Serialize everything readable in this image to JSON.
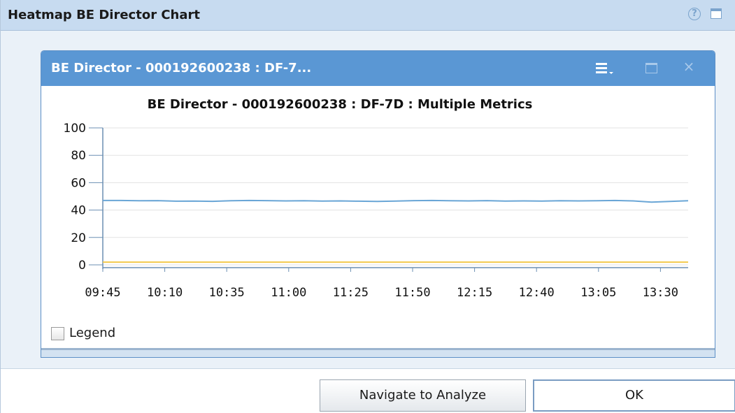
{
  "dialog": {
    "title": "Heatmap BE Director Chart",
    "help_icon": "help-circle-icon",
    "maximize_icon": "maximize-icon"
  },
  "panel": {
    "title": "BE Director - 000192600238 : DF-7...",
    "menu_icon": "panel-menu-icon",
    "maximize_icon": "panel-maximize-icon",
    "close_icon": "close-icon",
    "close_glyph": "×"
  },
  "chart_data": {
    "type": "line",
    "title": "BE Director - 000192600238 : DF-7D : Multiple Metrics",
    "xlabel": "",
    "ylabel": "",
    "ylim": [
      0,
      100
    ],
    "yticks": [
      0,
      20,
      40,
      60,
      80,
      100
    ],
    "xticks": [
      "09:45",
      "10:10",
      "10:35",
      "11:00",
      "11:25",
      "11:50",
      "12:15",
      "12:40",
      "13:05",
      "13:30"
    ],
    "grid": true,
    "series": [
      {
        "color": "#6aa6d6",
        "values": [
          47,
          47,
          46.8,
          46.9,
          46.5,
          46.6,
          46.4,
          46.8,
          47,
          46.9,
          46.7,
          46.8,
          46.6,
          46.7,
          46.5,
          46.3,
          46.6,
          46.9,
          47,
          46.8,
          46.7,
          46.9,
          46.6,
          46.7,
          46.6,
          46.8,
          46.7,
          46.8,
          47,
          46.7,
          45.8,
          46.3,
          46.8
        ]
      },
      {
        "color": "#f2c94c",
        "values": [
          2,
          2,
          2,
          2,
          2,
          2,
          2,
          2,
          2,
          2,
          2,
          2,
          2,
          2,
          2,
          2,
          2,
          2,
          2,
          2,
          2,
          2,
          2,
          2,
          2,
          2,
          2,
          2,
          2,
          2,
          2,
          2,
          2
        ]
      }
    ]
  },
  "legend": {
    "label": "Legend"
  },
  "buttons": {
    "navigate": "Navigate to Analyze",
    "ok": "OK"
  }
}
